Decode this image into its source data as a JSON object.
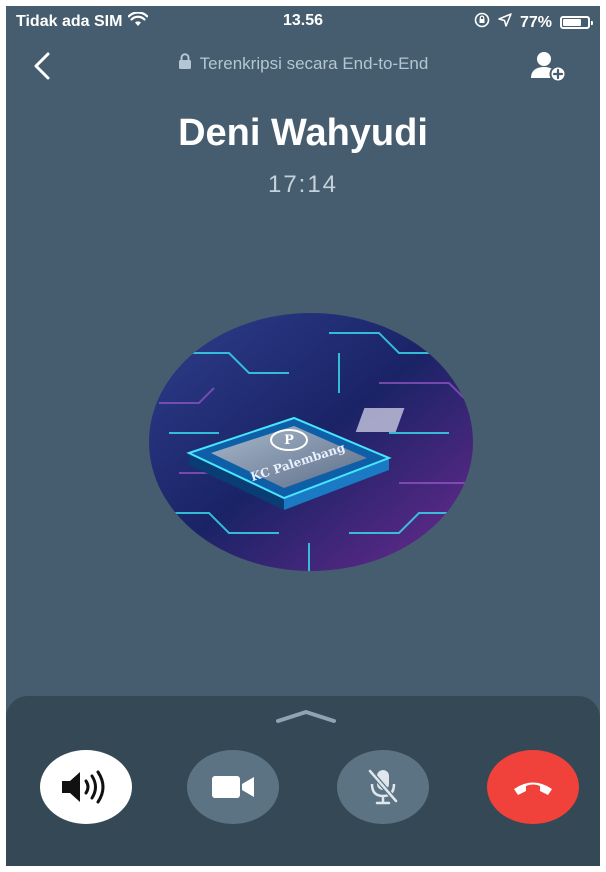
{
  "status_bar": {
    "carrier": "Tidak ada SIM",
    "time": "13.56",
    "battery_percent": "77%",
    "battery_level": 0.77
  },
  "header": {
    "encryption_text": "Terenkripsi secara End-to-End"
  },
  "contact": {
    "name": "Deni Wahyudi",
    "duration": "17:14",
    "avatar_text": "KC Palembang"
  },
  "colors": {
    "background": "#455d6e",
    "panel": "#354855",
    "button": "#5c7384",
    "end_call": "#f0413b",
    "speaker_active": "#ffffff"
  },
  "icons": {
    "back": "chevron-left-icon",
    "lock": "lock-icon",
    "add_person": "add-person-icon",
    "wifi": "wifi-icon",
    "orientation_lock": "orientation-lock-icon",
    "location": "location-arrow-icon",
    "battery": "battery-icon",
    "speaker": "speaker-icon",
    "video": "video-camera-icon",
    "mute": "microphone-off-icon",
    "end_call": "phone-hangup-icon",
    "expand": "chevron-up-icon"
  },
  "controls": {
    "speaker_active": true,
    "video_active": false,
    "muted": false
  }
}
